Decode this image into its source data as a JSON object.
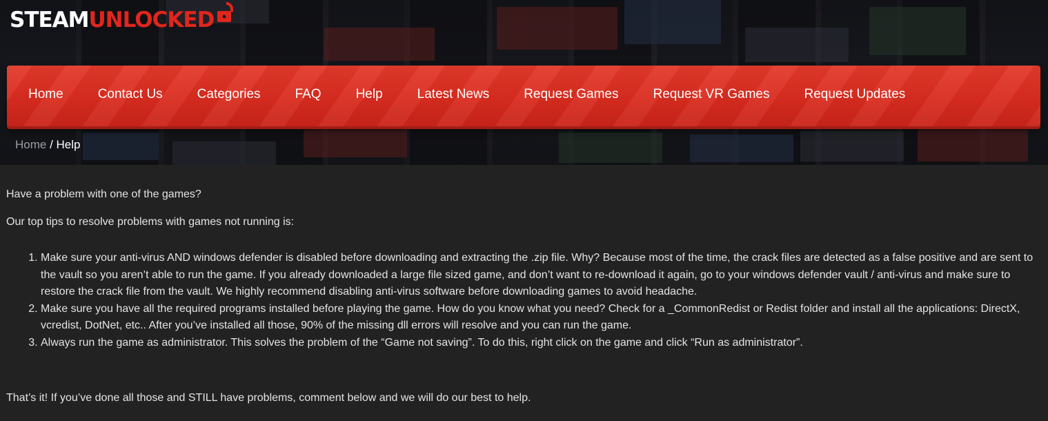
{
  "brand": {
    "logo_white": "STEAM",
    "logo_red": "UNLOCKED",
    "accent": "#e0261d",
    "nav_red": "#dd3122",
    "background": "#222222"
  },
  "nav": {
    "items": [
      {
        "label": "Home"
      },
      {
        "label": "Contact Us"
      },
      {
        "label": "Categories"
      },
      {
        "label": "FAQ"
      },
      {
        "label": "Help"
      },
      {
        "label": "Latest News"
      },
      {
        "label": "Request Games"
      },
      {
        "label": "Request VR Games"
      },
      {
        "label": "Request Updates"
      }
    ]
  },
  "breadcrumb": {
    "home": "Home",
    "separator": " / ",
    "current": "Help"
  },
  "content": {
    "intro": "Have a problem with one of the games?",
    "lead": "Our top tips to resolve problems with games not running is:",
    "tips": [
      "Make sure your anti-virus AND windows defender is disabled before downloading and extracting the .zip file. Why? Because most of the time, the crack files are detected as a false positive and are sent to the vault so you aren’t able to run the game. If you already downloaded a large file sized game, and don’t want to re-download it again, go to your windows defender vault / anti-virus and make sure to restore the crack file from the vault. We highly recommend disabling anti-virus software before downloading games to avoid headache.",
      "Make sure you have all the required programs installed before playing the game. How do you know what you need? Check for a _CommonRedist or Redist folder and install all the applications: DirectX, vcredist, DotNet, etc.. After you’ve installed all those, 90% of the missing dll errors will resolve and you can run the game.",
      "Always run the game as administrator. This solves the problem of the “Game not saving”. To do this, right click on the game and click “Run as administrator”."
    ],
    "closing": "That’s it! If you’ve done all those and STILL have problems, comment below and we will do our best to help."
  },
  "icons": {
    "logo_lock": "unlocked-padlock-icon"
  }
}
